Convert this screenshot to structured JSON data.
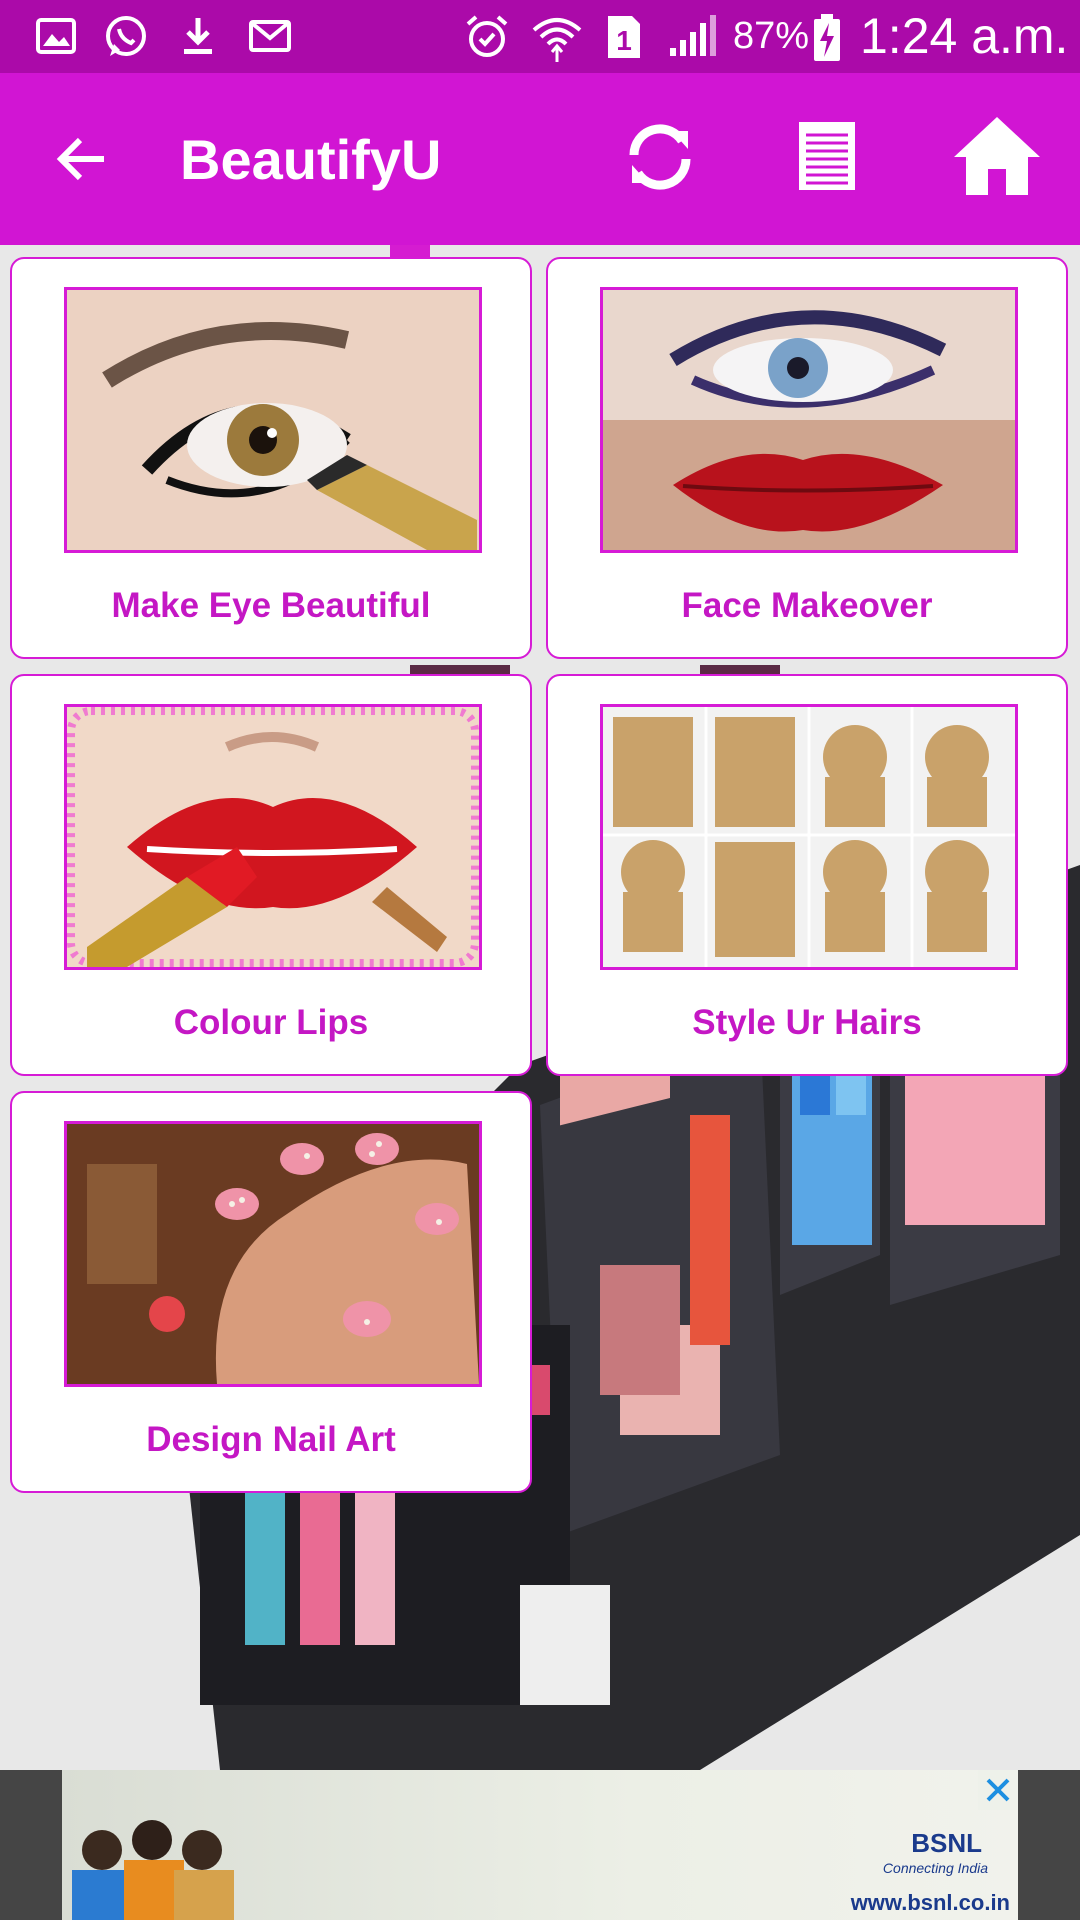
{
  "status_bar": {
    "battery": "87%",
    "time": "1:24 a.m.",
    "left_icons": [
      "image-icon",
      "whatsapp-icon",
      "download-icon",
      "gmail-icon"
    ],
    "right_icons": [
      "alarm-icon",
      "wifi-icon",
      "sim-1-icon",
      "signal-icon",
      "battery-charging-icon"
    ]
  },
  "app_bar": {
    "title": "BeautifyU",
    "actions": [
      "back-arrow-icon",
      "refresh-icon",
      "list-icon",
      "home-icon"
    ]
  },
  "cards": [
    {
      "label": "Make Eye Beautiful"
    },
    {
      "label": "Face Makeover"
    },
    {
      "label": "Colour Lips"
    },
    {
      "label": "Style Ur Hairs"
    },
    {
      "label": "Design Nail Art"
    }
  ],
  "ad": {
    "brand": "BSNL",
    "tagline": "Connecting India",
    "url": "www.bsnl.co.in"
  },
  "colors": {
    "status_bar": "#ab0aa9",
    "app_bar": "#d115d3",
    "accent": "#d61bd6",
    "label": "#c417c4"
  }
}
